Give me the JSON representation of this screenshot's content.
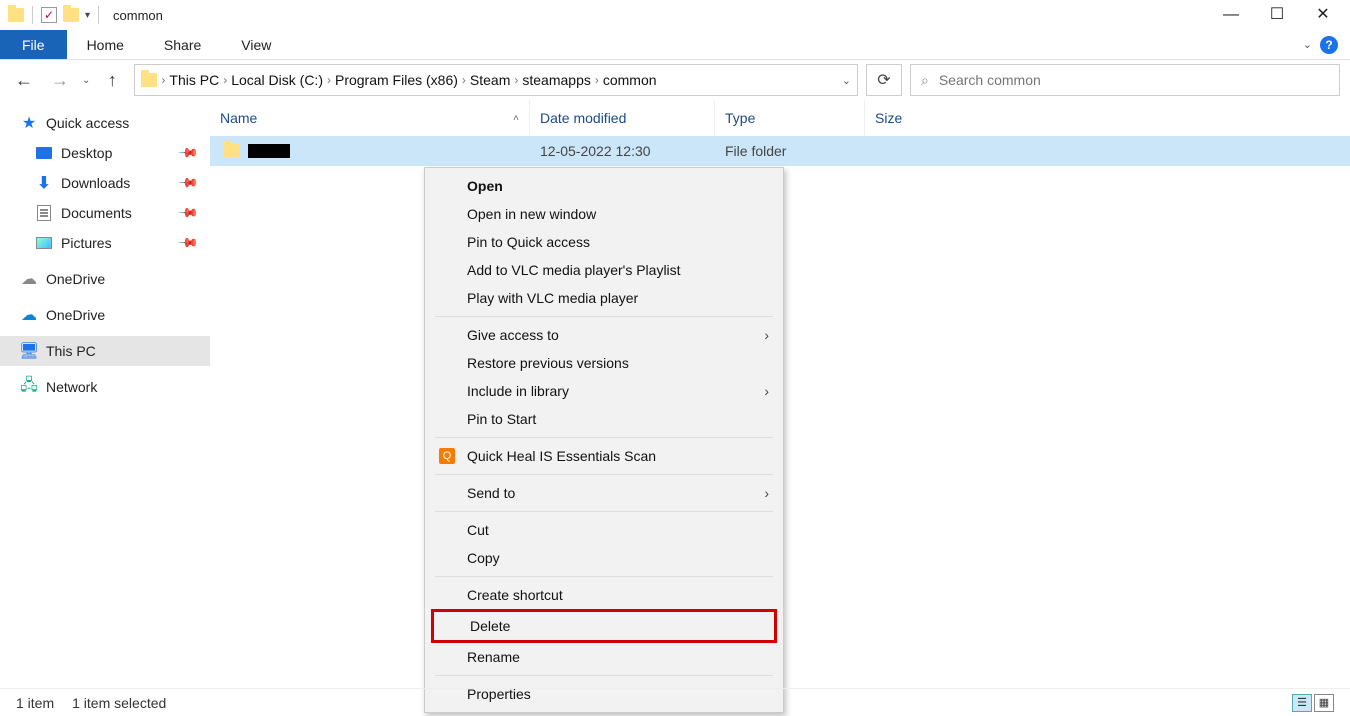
{
  "titlebar": {
    "title": "common"
  },
  "menubar": {
    "file": "File",
    "home": "Home",
    "share": "Share",
    "view": "View"
  },
  "breadcrumbs": {
    "pc": "This PC",
    "disk": "Local Disk (C:)",
    "pf": "Program Files (x86)",
    "steam": "Steam",
    "apps": "steamapps",
    "common": "common"
  },
  "search": {
    "placeholder": "Search common"
  },
  "sidebar": {
    "quick": "Quick access",
    "desktop": "Desktop",
    "downloads": "Downloads",
    "documents": "Documents",
    "pictures": "Pictures",
    "onedrive1": "OneDrive",
    "onedrive2": "OneDrive",
    "thispc": "This PC",
    "network": "Network"
  },
  "columns": {
    "name": "Name",
    "date": "Date modified",
    "type": "Type",
    "size": "Size"
  },
  "row": {
    "date": "12-05-2022 12:30",
    "type": "File folder"
  },
  "context_menu": {
    "open": "Open",
    "open_new": "Open in new window",
    "pin_quick": "Pin to Quick access",
    "add_vlc": "Add to VLC media player's Playlist",
    "play_vlc": "Play with VLC media player",
    "give_access": "Give access to",
    "restore": "Restore previous versions",
    "include_lib": "Include in library",
    "pin_start": "Pin to Start",
    "quickheal": "Quick Heal IS Essentials Scan",
    "send_to": "Send to",
    "cut": "Cut",
    "copy": "Copy",
    "shortcut": "Create shortcut",
    "delete": "Delete",
    "rename": "Rename",
    "properties": "Properties"
  },
  "statusbar": {
    "items": "1 item",
    "selected": "1 item selected"
  }
}
